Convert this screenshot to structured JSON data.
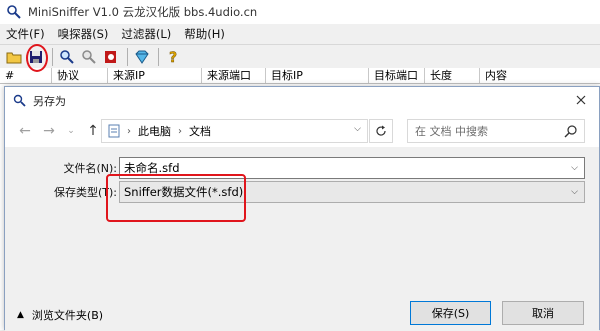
{
  "app": {
    "title": "MiniSniffer V1.0 云龙汉化版 bbs.4udio.cn",
    "menu": [
      "文件(F)",
      "嗅探器(S)",
      "过滤器(L)",
      "帮助(H)"
    ]
  },
  "toolbar": {
    "icons": [
      "open-folder-icon",
      "save-disk-icon",
      "search-icon",
      "search-disabled-icon",
      "stop-icon",
      "filter-gem-icon",
      "help-icon"
    ]
  },
  "columns": [
    "#",
    "协议",
    "来源IP",
    "来源端口",
    "目标IP",
    "目标端口",
    "长度",
    "内容"
  ],
  "dialog": {
    "title": "另存为",
    "breadcrumb": [
      "此电脑",
      "文档"
    ],
    "search_placeholder": "在 文档 中搜索",
    "filename_label": "文件名(N):",
    "filename_value": "未命名.sfd",
    "filetype_label": "保存类型(T):",
    "filetype_value": "Sniffer数据文件(*.sfd)",
    "browse_label": "浏览文件夹(B)",
    "save_button": "保存(S)",
    "cancel_button": "取消"
  },
  "colors": {
    "annotation": "#e0151c",
    "primary_button_border": "#0078d7"
  }
}
